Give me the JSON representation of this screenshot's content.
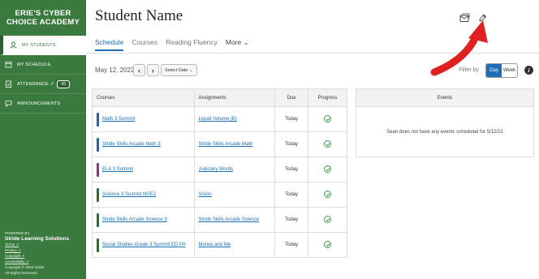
{
  "sidebar": {
    "brand": "ERIE'S CYBER CHOICE ACADEMY",
    "items": [
      {
        "label": "MY STUDENTS",
        "icon": "user-icon"
      },
      {
        "label": "MY SCHEDULE",
        "icon": "calendar-icon"
      },
      {
        "label": "ATTENDANCE ↗",
        "icon": "clipboard-icon",
        "badge": "40"
      },
      {
        "label": "ANNOUNCEMENTS",
        "icon": "chat-icon"
      }
    ],
    "footer": {
      "powered": "POWERED BY",
      "company": "Stride Learning Solutions",
      "links": [
        "Terms ↗",
        "Privacy ↗",
        "Copyright ↗",
        "Accessibility ↗"
      ],
      "copyright": "Copyright © 2022 Stride.",
      "rights": "All Rights Reserved"
    }
  },
  "header": {
    "title": "Student Name",
    "tabs": [
      "Schedule",
      "Courses",
      "Reading Fluency",
      "More ⌄"
    ]
  },
  "toolbar": {
    "date": "May 12, 2022",
    "prev": "‹",
    "next": "›",
    "select_date": "Select Date ⌄",
    "filter_by": "Filter by",
    "day": "Day",
    "week": "Week",
    "info": "i"
  },
  "courses_table": {
    "headers": [
      "Courses",
      "Assignments",
      "Due",
      "Progress"
    ],
    "rows": [
      {
        "course": "Math 3 Summit",
        "assignment": "Liquid Volume (B)",
        "due": "Today",
        "color": "#2d5fa8"
      },
      {
        "course": "Stride Skills Arcade Math 3",
        "assignment": "Stride Skills Arcade Math",
        "due": "Today",
        "color": "#2d5fa8"
      },
      {
        "course": "ELA 3 Summit",
        "assignment": "Judiciary Words",
        "due": "Today",
        "color": "#8e2d8e"
      },
      {
        "course": "Science 3 Summit NGE2",
        "assignment": "Vision",
        "due": "Today",
        "color": "#2f6b36"
      },
      {
        "course": "Stride Skills Arcade Science 3",
        "assignment": "Stride Skills Arcade Science",
        "due": "Today",
        "color": "#2f6b36"
      },
      {
        "course": "Social Studies Grade 3 Summit ED PA",
        "assignment": "Money and Me",
        "due": "Today",
        "color": "#2f6b36"
      }
    ]
  },
  "events": {
    "header": "Events",
    "empty": "Sean does not have any events scheduled for 5/12/22"
  },
  "colors": {
    "sidebar": "#3b7a3f",
    "accent": "#1a6fb5",
    "arrow": "#e02020"
  }
}
